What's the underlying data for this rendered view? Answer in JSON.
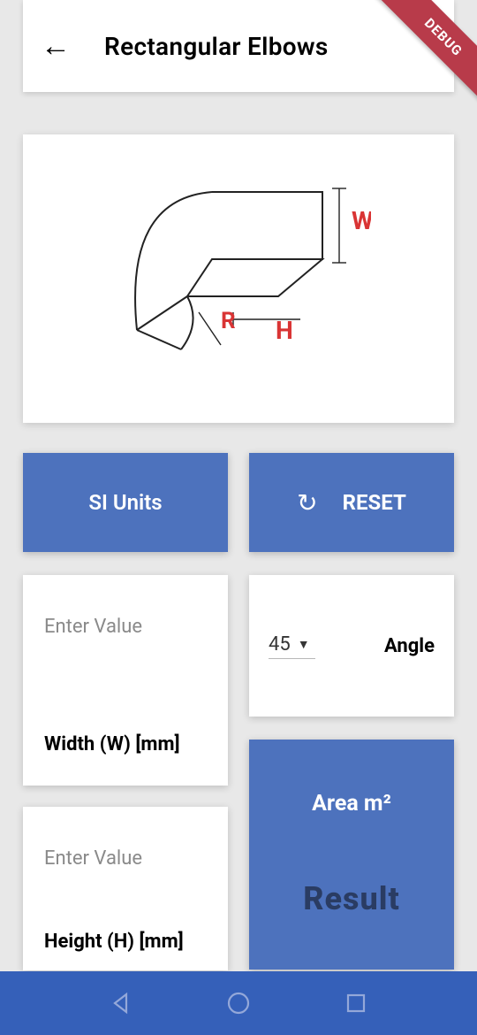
{
  "header": {
    "title": "Rectangular Elbows",
    "debug_banner": "DEBUG"
  },
  "diagram": {
    "labels": {
      "W": "W",
      "R": "R",
      "H": "H"
    }
  },
  "buttons": {
    "units": "SI Units",
    "reset": "RESET"
  },
  "inputs": {
    "width": {
      "placeholder": "Enter Value",
      "label": "Width (W) [mm]"
    },
    "height": {
      "placeholder": "Enter Value",
      "label": "Height (H) [mm]"
    },
    "angle": {
      "label": "Angle",
      "selected": "45"
    }
  },
  "result": {
    "title": "Area m²",
    "value": "Result"
  }
}
